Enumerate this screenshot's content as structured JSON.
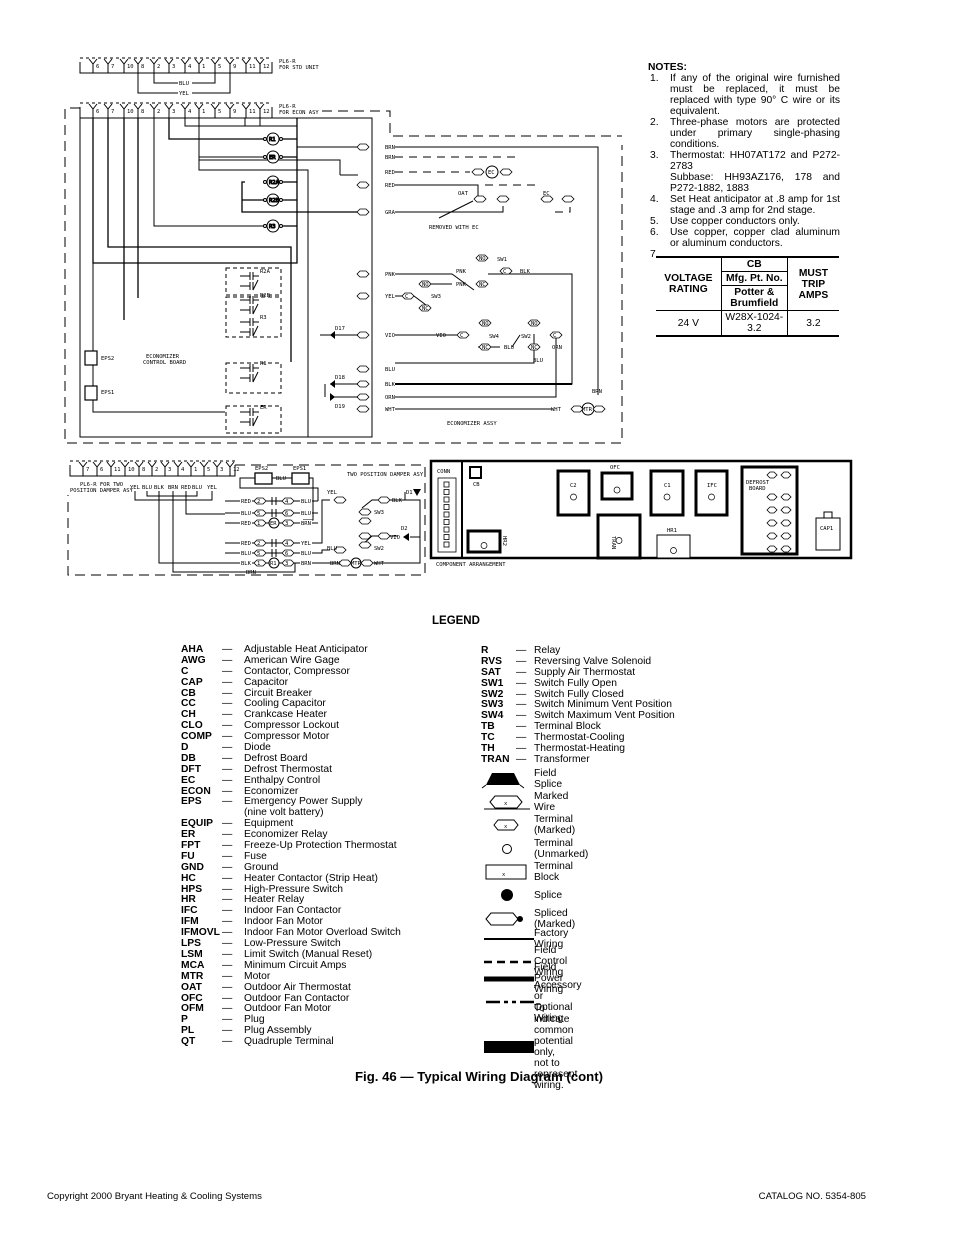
{
  "diagram": {
    "plug_std": {
      "pins": [
        "6",
        "7",
        "10",
        "8",
        "2",
        "3",
        "4",
        "1",
        "5",
        "9",
        "11",
        "12"
      ],
      "label1": "PL6-R",
      "label2": "FOR STD UNIT",
      "wire1": "BLU",
      "wire2": "YEL"
    },
    "plug_econ": {
      "pins": [
        "6",
        "7",
        "10",
        "8",
        "2",
        "3",
        "4",
        "1",
        "5",
        "9",
        "11",
        "12"
      ],
      "label1": "PL6-R",
      "label2": "FOR ECON ASY"
    },
    "coils": [
      "R1",
      "ER",
      "R2A",
      "R2B",
      "R3"
    ],
    "contacts": [
      "R2A",
      "R2B",
      "R3",
      "R1",
      "ER"
    ],
    "batteries": [
      "EPS2",
      "EPS1"
    ],
    "board_label1": "ECONOMIZER",
    "board_label2": "CONTROL BOARD",
    "diodes": [
      "D17",
      "D18",
      "D19"
    ],
    "board_wires": [
      "BRN",
      "BRN",
      "RED",
      "RED",
      "GRA",
      "PNK",
      "YEL",
      "VIO",
      "BLU",
      "BLK",
      "ORN",
      "WHT"
    ],
    "ec": "EC",
    "oat": "OAT",
    "ec_sw": "EC",
    "removed_note": "REMOVED WITH EC",
    "sw1": {
      "name": "SW1",
      "no": "NO",
      "nc": "NC",
      "c": "C",
      "w1": "PNK",
      "w2": "PNK",
      "w3": "BLK"
    },
    "sw3": {
      "name": "SW3",
      "c": "C",
      "nc": "NC"
    },
    "sw4": {
      "name": "SW4",
      "no": "NO",
      "nc": "NC",
      "c": "C",
      "w1": "VIO"
    },
    "sw2": {
      "name": "SW2",
      "no": "NO",
      "nc": "NC",
      "c": "C",
      "w1": "BLU",
      "w2": "BLU",
      "w3": "ORN"
    },
    "mtr": {
      "name": "MTR",
      "w1": "WHT",
      "w2": "BRN"
    },
    "econ_assy": "ECONOMIZER ASSY"
  },
  "damper": {
    "plug_pins": [
      "7",
      "6",
      "11",
      "10",
      "8",
      "2",
      "3",
      "4",
      "1",
      "5",
      "3",
      "12"
    ],
    "plug_label1": "PL6-R FOR TWO",
    "plug_label2": "POSITION DAMPER ASY",
    "plug_wires": [
      "YEL",
      "BLU",
      "BLK",
      "BRN",
      "RED",
      "BLU",
      "YEL"
    ],
    "eps": [
      "EPS2",
      "EPS1"
    ],
    "eps_wire": "BLU",
    "title": "TWO POSITION DAMPER ASY",
    "rows": [
      {
        "l": "RED",
        "a": "2",
        "b": "4",
        "r": "BLU"
      },
      {
        "l": "BLU",
        "a": "5",
        "b": "6",
        "r": "BLU"
      },
      {
        "l": "RED",
        "a": "1",
        "coil": "ER",
        "b": "3",
        "r": "BRN"
      },
      {
        "l": "RED",
        "a": "2",
        "b": "4",
        "r": "YEL"
      },
      {
        "l": "BLU",
        "a": "5",
        "b": "6",
        "r": "BLU"
      },
      {
        "l": "BLK",
        "a": "1",
        "coil": "R1",
        "b": "3",
        "r": "BRN"
      }
    ],
    "bottom_wire": "BRN",
    "sw3": "SW3",
    "sw2": "SW2",
    "d1": "D1",
    "d2": "D2",
    "yel": "YEL",
    "blk": "BLK",
    "vio": "VIO",
    "blu": "BLU",
    "brn": "BRN",
    "mtr": "MTR",
    "wht": "WHT"
  },
  "components": {
    "conn": "CONN",
    "cb": "CB",
    "c2": "C2",
    "ofc": "OFC",
    "c1": "C1",
    "ifc": "IFC",
    "defrost1": "DEFROST",
    "defrost2": "BOARD",
    "tran": "TRAN",
    "hr1": "HR1",
    "hr2": "HR2",
    "cap1": "CAP1",
    "caption": "COMPONENT ARRANGEMENT"
  },
  "notes": {
    "title": "NOTES:",
    "items": [
      {
        "n": "1.",
        "text": "If any of the original wire furnished must be replaced, it must be replaced with type 90° C wire or its equivalent."
      },
      {
        "n": "2.",
        "text": "Three-phase motors are protected under primary single-phasing conditions."
      },
      {
        "n": "3.",
        "text": "Thermostat: HH07AT172 and P272-2783"
      },
      {
        "n": "",
        "text": "Subbase: HH93AZ176, 178 and P272-1882, 1883"
      },
      {
        "n": "4.",
        "text": "Set Heat anticipator at .8 amp for 1st stage and .3 amp for 2nd stage."
      },
      {
        "n": "5.",
        "text": "Use copper conductors only."
      },
      {
        "n": "6.",
        "text": "Use copper, copper clad aluminum or aluminum conductors."
      },
      {
        "n": "7.",
        "text": ""
      }
    ],
    "table": {
      "voltage_header": "VOLTAGE RATING",
      "cb_header": "CB",
      "mfg_header": "Mfg. Pt. No.",
      "maker_header": "Potter & Brumfield",
      "trip_header": "MUST TRIP AMPS",
      "row": {
        "voltage": "24 V",
        "part": "W28X-1024-3.2",
        "amps": "3.2"
      }
    }
  },
  "legend": {
    "title": "LEGEND",
    "dash": "—",
    "left": [
      {
        "abbr": "AHA",
        "desc": "Adjustable Heat Anticipator"
      },
      {
        "abbr": "AWG",
        "desc": "American Wire Gage"
      },
      {
        "abbr": "C",
        "desc": "Contactor, Compressor"
      },
      {
        "abbr": "CAP",
        "desc": "Capacitor"
      },
      {
        "abbr": "CB",
        "desc": "Circuit Breaker"
      },
      {
        "abbr": "CC",
        "desc": "Cooling Capacitor"
      },
      {
        "abbr": "CH",
        "desc": "Crankcase Heater"
      },
      {
        "abbr": "CLO",
        "desc": "Compressor Lockout"
      },
      {
        "abbr": "COMP",
        "desc": "Compressor Motor"
      },
      {
        "abbr": "D",
        "desc": "Diode"
      },
      {
        "abbr": "DB",
        "desc": "Defrost Board"
      },
      {
        "abbr": "DFT",
        "desc": "Defrost Thermostat"
      },
      {
        "abbr": "EC",
        "desc": "Enthalpy Control"
      },
      {
        "abbr": "ECON",
        "desc": "Economizer"
      },
      {
        "abbr": "EPS",
        "desc": "Emergency Power Supply"
      },
      {
        "abbr": "",
        "desc": "(nine volt battery)"
      },
      {
        "abbr": "EQUIP",
        "desc": "Equipment"
      },
      {
        "abbr": "ER",
        "desc": "Economizer Relay"
      },
      {
        "abbr": "FPT",
        "desc": "Freeze-Up Protection Thermostat"
      },
      {
        "abbr": "FU",
        "desc": "Fuse"
      },
      {
        "abbr": "GND",
        "desc": "Ground"
      },
      {
        "abbr": "HC",
        "desc": "Heater Contactor (Strip Heat)"
      },
      {
        "abbr": "HPS",
        "desc": "High-Pressure Switch"
      },
      {
        "abbr": "HR",
        "desc": "Heater Relay"
      },
      {
        "abbr": "IFC",
        "desc": "Indoor Fan Contactor"
      },
      {
        "abbr": "IFM",
        "desc": "Indoor Fan Motor"
      },
      {
        "abbr": "IFMOVL",
        "desc": "Indoor Fan Motor Overload Switch"
      },
      {
        "abbr": "LPS",
        "desc": "Low-Pressure Switch"
      },
      {
        "abbr": "LSM",
        "desc": "Limit Switch (Manual Reset)"
      },
      {
        "abbr": "MCA",
        "desc": "Minimum Circuit Amps"
      },
      {
        "abbr": "MTR",
        "desc": "Motor"
      },
      {
        "abbr": "OAT",
        "desc": "Outdoor Air Thermostat"
      },
      {
        "abbr": "OFC",
        "desc": "Outdoor Fan Contactor"
      },
      {
        "abbr": "OFM",
        "desc": "Outdoor Fan Motor"
      },
      {
        "abbr": "P",
        "desc": "Plug"
      },
      {
        "abbr": "PL",
        "desc": "Plug Assembly"
      },
      {
        "abbr": "QT",
        "desc": "Quadruple Terminal"
      }
    ],
    "right": [
      {
        "abbr": "R",
        "desc": "Relay"
      },
      {
        "abbr": "RVS",
        "desc": "Reversing Valve Solenoid"
      },
      {
        "abbr": "SAT",
        "desc": "Supply Air Thermostat"
      },
      {
        "abbr": "SW1",
        "desc": "Switch Fully Open"
      },
      {
        "abbr": "SW2",
        "desc": "Switch Fully Closed"
      },
      {
        "abbr": "SW3",
        "desc": "Switch Minimum Vent Position"
      },
      {
        "abbr": "SW4",
        "desc": "Switch Maximum Vent Position"
      },
      {
        "abbr": "TB",
        "desc": "Terminal Block"
      },
      {
        "abbr": "TC",
        "desc": "Thermostat-Cooling"
      },
      {
        "abbr": "TH",
        "desc": "Thermostat-Heating"
      },
      {
        "abbr": "TRAN",
        "desc": "Transformer"
      }
    ],
    "symbols": [
      {
        "icon": "field-splice",
        "label": "Field Splice"
      },
      {
        "icon": "marked-wire",
        "label": "Marked Wire",
        "mark": "x"
      },
      {
        "icon": "terminal-marked",
        "label": "Terminal (Marked)",
        "mark": "x"
      },
      {
        "icon": "terminal-unmarked",
        "label": "Terminal (Unmarked)"
      },
      {
        "icon": "terminal-block",
        "label": "Terminal Block",
        "mark": "x"
      },
      {
        "icon": "splice",
        "label": "Splice"
      },
      {
        "icon": "spliced-marked",
        "label": "Spliced (Marked)"
      },
      {
        "icon": "factory-wiring",
        "label": "Factory Wiring"
      },
      {
        "icon": "field-control-wiring",
        "label": "Field Control Wiring"
      },
      {
        "icon": "field-power-wiring",
        "label": "Field Power Wiring"
      },
      {
        "icon": "accessory-wiring",
        "label": "Accessory or Optional Wiring"
      },
      {
        "icon": "common-potential",
        "label1": "To indicate common potential only,",
        "label2": "not to represent wiring."
      }
    ]
  },
  "caption": "Fig. 46 — Typical Wiring Diagram (cont)",
  "footer": {
    "copyright": "Copyright 2000 Bryant Heating & Cooling Systems",
    "catalog": "CATALOG NO. 5354-805"
  }
}
